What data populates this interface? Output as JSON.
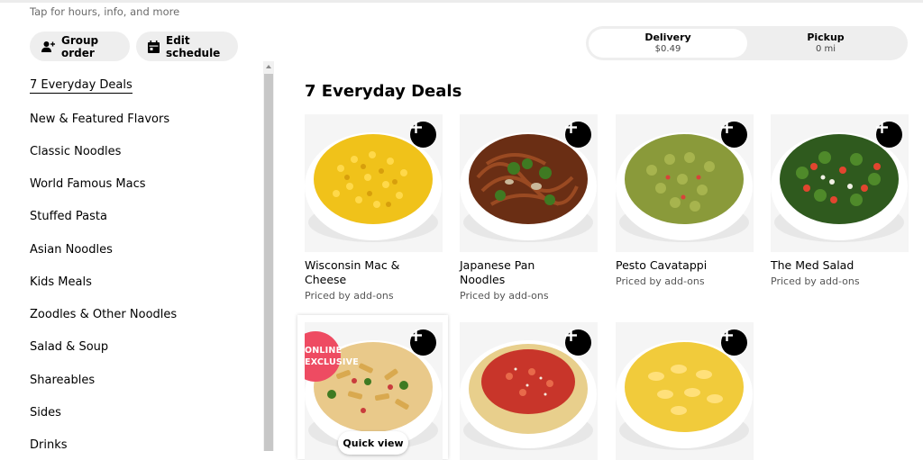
{
  "store": {
    "info_link": "Tap for hours, info, and more"
  },
  "actions": {
    "group_order": "Group order",
    "edit_schedule": "Edit schedule"
  },
  "mode": {
    "delivery": {
      "label": "Delivery",
      "fee": "$0.49"
    },
    "pickup": {
      "label": "Pickup",
      "distance": "0 mi"
    },
    "selected": "delivery"
  },
  "nav": {
    "items": [
      {
        "label": "7 Everyday Deals"
      },
      {
        "label": "New & Featured Flavors"
      },
      {
        "label": "Classic Noodles"
      },
      {
        "label": "World Famous Macs"
      },
      {
        "label": "Stuffed Pasta"
      },
      {
        "label": "Asian Noodles"
      },
      {
        "label": "Kids Meals"
      },
      {
        "label": "Zoodles & Other Noodles"
      },
      {
        "label": "Salad & Soup"
      },
      {
        "label": "Shareables"
      },
      {
        "label": "Sides"
      },
      {
        "label": "Drinks"
      }
    ]
  },
  "section": {
    "title": "7 Everyday Deals",
    "items": [
      {
        "name": "Wisconsin Mac & Cheese",
        "price": "Priced by add-ons",
        "icon": "mac-cheese-bowl"
      },
      {
        "name": "Japanese Pan Noodles",
        "price": "Priced by add-ons",
        "icon": "pan-noodles-bowl"
      },
      {
        "name": "Pesto Cavatappi",
        "price": "Priced by add-ons",
        "icon": "pesto-bowl"
      },
      {
        "name": "The Med Salad",
        "price": "Priced by add-ons",
        "icon": "salad-bowl"
      },
      {
        "badge_line1": "ONLINE",
        "badge_line2": "EXCLUSIVE",
        "quick_view": "Quick view",
        "icon": "penne-bowl"
      },
      {
        "icon": "spaghetti-bowl"
      },
      {
        "icon": "egg-noodles-bowl"
      }
    ]
  },
  "colors": {
    "badge": "#ee4b62",
    "add_button": "#000000",
    "pill_bg": "#eeeeee"
  }
}
